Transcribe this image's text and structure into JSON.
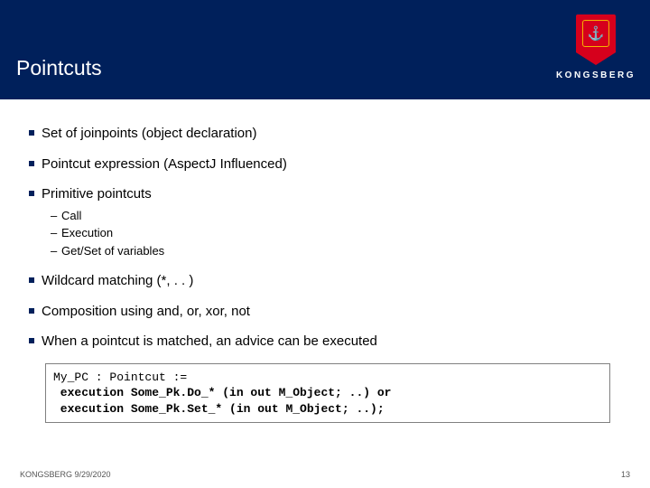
{
  "brand": {
    "name": "KONGSBERG",
    "crest_glyph": "⚓"
  },
  "slide": {
    "title": "Pointcuts"
  },
  "bullets": [
    {
      "text": "Set of joinpoints (object declaration)"
    },
    {
      "text": "Pointcut expression (AspectJ Influenced)"
    },
    {
      "text": "Primitive pointcuts",
      "subs": [
        "Call",
        "Execution",
        "Get/Set of variables"
      ]
    },
    {
      "text": "Wildcard matching (*, . . )"
    },
    {
      "text": "Composition using and, or, xor, not"
    },
    {
      "text": "When a pointcut is matched, an advice can be executed"
    }
  ],
  "code": {
    "line1": "My_PC : Pointcut :=",
    "line2": " execution Some_Pk.Do_* (in out M_Object; ..) or",
    "line3": " execution Some_Pk.Set_* (in out M_Object; ..);"
  },
  "footer": {
    "left": "KONGSBERG 9/29/2020",
    "page": "13"
  }
}
